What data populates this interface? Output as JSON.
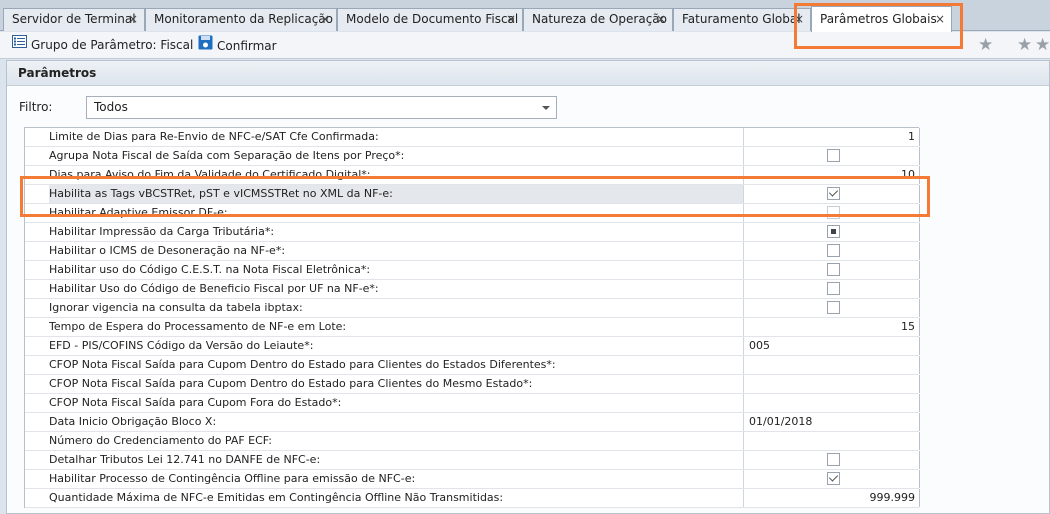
{
  "tabs": [
    {
      "label": "Servidor de Terminal",
      "close": "×"
    },
    {
      "label": "Monitoramento da Replicação",
      "close": "×"
    },
    {
      "label": "Modelo de Documento Fiscal",
      "close": "×"
    },
    {
      "label": "Natureza de Operação",
      "close": "×"
    },
    {
      "label": "Faturamento Global",
      "close": "×"
    },
    {
      "label": "Parâmetros Globais",
      "close": "×"
    }
  ],
  "toolbar": {
    "group_label": "Grupo de Parâmetro: Fiscal",
    "confirm_label": "Confirmar",
    "star_glyph": "★"
  },
  "panel": {
    "title": "Parâmetros",
    "filter_label": "Filtro:",
    "filter_value": "Todos"
  },
  "rows": [
    {
      "name": "Limite de Dias para Re-Envio de NFC-e/SAT Cfe Confirmada:",
      "kind": "num",
      "value": "1"
    },
    {
      "name": "Agrupa Nota Fiscal de Saída com Separação de Itens por Preço*:",
      "kind": "check",
      "state": "unchecked"
    },
    {
      "name": "Dias para Aviso do Fim da Validade do Certificado Digital*:",
      "kind": "num",
      "value": "10"
    },
    {
      "name": "Habilita as Tags vBCSTRet, pST e vICMSSTRet no XML da NF-e:",
      "kind": "check",
      "state": "checked",
      "selected": true
    },
    {
      "name": "Habilitar Adaptive Emissor DF-e:",
      "kind": "check",
      "state": "disabled"
    },
    {
      "name": "Habilitar Impressão da Carga Tributária*:",
      "kind": "check",
      "state": "mixed"
    },
    {
      "name": "Habilitar o ICMS de Desoneração na NF-e*:",
      "kind": "check",
      "state": "unchecked"
    },
    {
      "name": "Habilitar uso do Código C.E.S.T. na Nota Fiscal Eletrônica*:",
      "kind": "check",
      "state": "unchecked"
    },
    {
      "name": "Habilitar Uso do Código de Beneficio Fiscal por UF na NF-e*:",
      "kind": "check",
      "state": "unchecked"
    },
    {
      "name": "Ignorar vigencia na consulta da tabela ibptax:",
      "kind": "check",
      "state": "unchecked"
    },
    {
      "name": "Tempo de Espera do Processamento de NF-e em Lote:",
      "kind": "num",
      "value": "15"
    },
    {
      "name": "EFD - PIS/COFINS Código da Versão do Leiaute*:",
      "kind": "text",
      "value": "005"
    },
    {
      "name": "CFOP Nota Fiscal Saída para Cupom Dentro do Estado para Clientes do Estados Diferentes*:",
      "kind": "text",
      "value": ""
    },
    {
      "name": "CFOP Nota Fiscal Saída para Cupom Dentro do Estado para Clientes do Mesmo Estado*:",
      "kind": "text",
      "value": ""
    },
    {
      "name": "CFOP Nota Fiscal Saída para Cupom Fora do Estado*:",
      "kind": "text",
      "value": ""
    },
    {
      "name": "Data Inicio Obrigação Bloco X:",
      "kind": "text",
      "value": "01/01/2018"
    },
    {
      "name": "Número do Credenciamento do PAF ECF:",
      "kind": "text",
      "value": ""
    },
    {
      "name": "Detalhar Tributos Lei 12.741 no DANFE de NFC-e:",
      "kind": "check",
      "state": "unchecked"
    },
    {
      "name": "Habilitar Processo de Contingência Offline para emissão de NFC-e:",
      "kind": "check",
      "state": "checked"
    },
    {
      "name": "Quantidade Máxima de NFC-e Emitidas em Contingência Offline Não Transmitidas:",
      "kind": "num",
      "value": "999.999"
    }
  ],
  "colors": {
    "highlight": "#f47b35",
    "confirm_icon": "#1f6fc0"
  }
}
